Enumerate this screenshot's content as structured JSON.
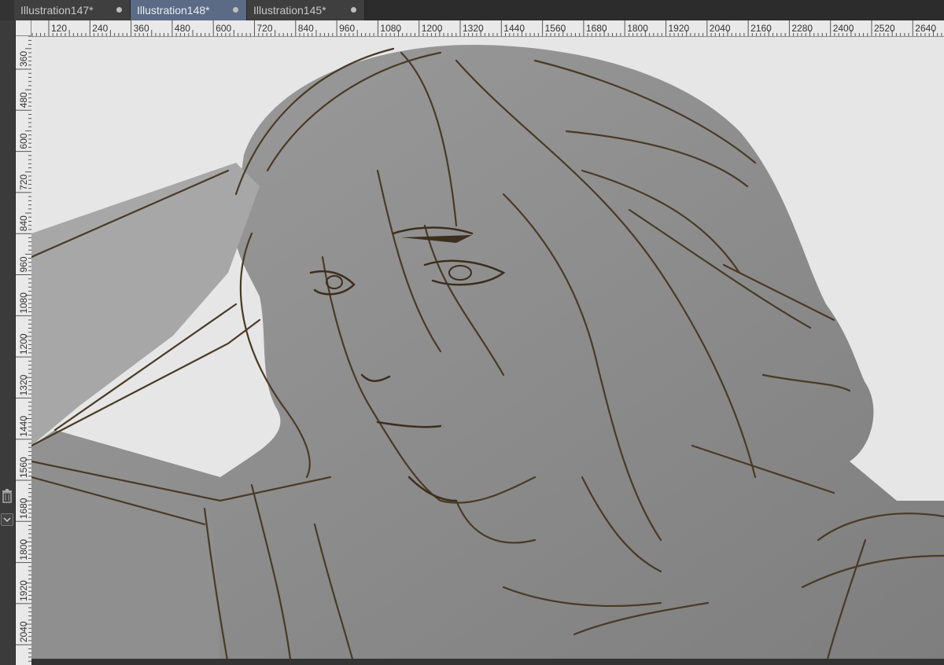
{
  "tabs": [
    {
      "label": "Illustration147*",
      "active": false
    },
    {
      "label": "Illustration148*",
      "active": true
    },
    {
      "label": "Illustration145*",
      "active": false
    }
  ],
  "rulers": {
    "horizontal_labels": [
      "120",
      "240",
      "360",
      "480",
      "600",
      "720",
      "840",
      "960",
      "1080",
      "1200",
      "1320",
      "1440",
      "1560",
      "1680",
      "1800",
      "1920",
      "2040",
      "2160",
      "2280",
      "2400",
      "2520",
      "2640"
    ],
    "vertical_labels": [
      "360",
      "480",
      "600",
      "720",
      "840",
      "960",
      "1080",
      "1200",
      "1320",
      "1440",
      "1560",
      "1680",
      "1800",
      "1920",
      "2040"
    ]
  },
  "icons": {
    "trash": "trash-icon",
    "dropdown": "chevron-down-icon",
    "tab_close": "dot-icon"
  },
  "colors": {
    "active_tab": "#5b6b86",
    "sketch_line": "#4a3a26",
    "canvas_bg": "#e6e6e6"
  }
}
